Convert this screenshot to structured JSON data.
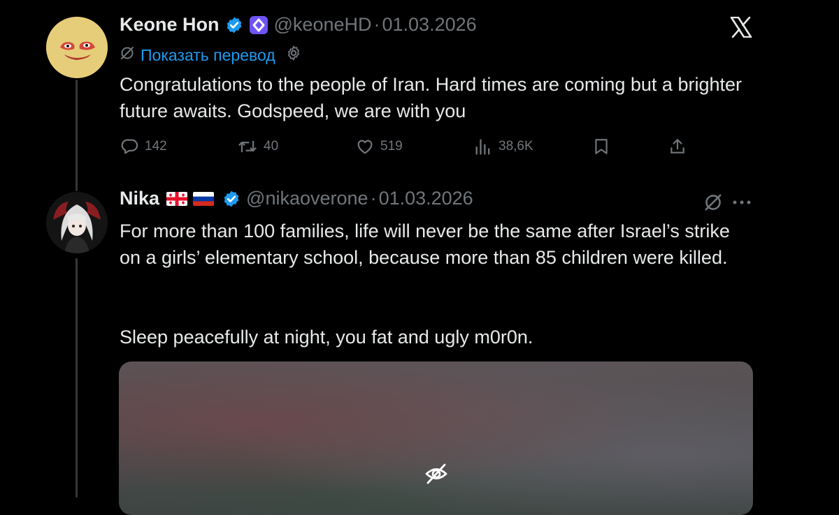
{
  "tweet1": {
    "name": "Keone Hon",
    "handle": "@keoneHD",
    "separator": "·",
    "date": "01.03.2026",
    "translate_label": "Показать перевод",
    "text": "Congratulations to the people of Iran. Hard times are coming but a brighter future awaits. Godspeed, we are with you",
    "stats": {
      "replies": "142",
      "reposts": "40",
      "likes": "519",
      "views": "38,6K"
    },
    "icons": [
      "verified-icon",
      "affiliate-badge-icon",
      "translate-icon",
      "gear-icon",
      "reply-icon",
      "repost-icon",
      "like-icon",
      "views-icon",
      "bookmark-icon",
      "share-icon"
    ]
  },
  "tweet2": {
    "name": "Nika",
    "handle": "@nikaoverone",
    "separator": "·",
    "date": "01.03.2026",
    "text_paragraph_1": "For more than 100 families, life will never be the same after Israel’s strike on a girls’ elementary school, because more than 85 children were killed.",
    "text_paragraph_2": "Sleep peacefully at night, you fat and ugly m0r0n.",
    "flags": [
      "georgia-flag",
      "russia-flag"
    ],
    "icons": [
      "verified-icon",
      "no-translate-icon",
      "more-icon",
      "hidden-media-icon"
    ]
  },
  "app_icon": "x-logo-icon",
  "colors": {
    "background": "#000000",
    "text": "#e7e9ea",
    "muted": "#71767b",
    "link": "#1d9bf0",
    "verified": "#1d9bf0",
    "thread_line": "#333639"
  }
}
